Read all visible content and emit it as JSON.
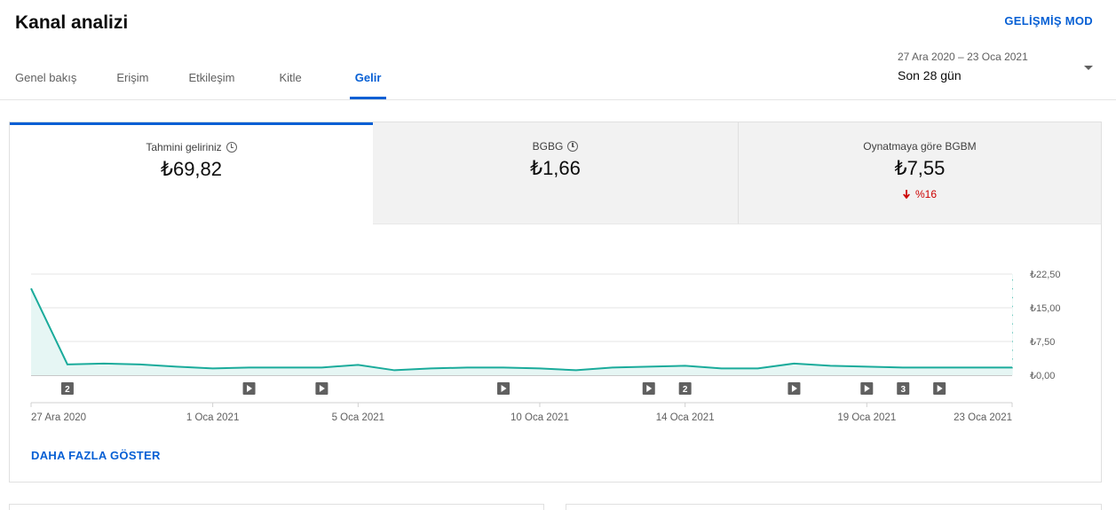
{
  "page": {
    "title": "Kanal analizi",
    "advanced_mode": "GELİŞMİŞ MOD"
  },
  "tabs": [
    {
      "label": "Genel bakış",
      "active": false
    },
    {
      "label": "Erişim",
      "active": false
    },
    {
      "label": "Etkileşim",
      "active": false
    },
    {
      "label": "Kitle",
      "active": false
    },
    {
      "label": "Gelir",
      "active": true
    }
  ],
  "date_range": {
    "range": "27 Ara 2020 – 23 Oca 2021",
    "label": "Son 28 gün"
  },
  "metrics": [
    {
      "label": "Tahmini geliriniz",
      "value": "₺69,82",
      "has_clock": true,
      "selected": true,
      "delta": ""
    },
    {
      "label": "BGBG",
      "value": "₺1,66",
      "has_clock": true,
      "selected": false,
      "delta": ""
    },
    {
      "label": "Oynatmaya göre BGBM",
      "value": "₺7,55",
      "has_clock": false,
      "selected": false,
      "delta": "%16"
    }
  ],
  "colors": {
    "accent": "#065fd4",
    "line": "#1aab9b",
    "negative": "#cc0000"
  },
  "chart_data": {
    "type": "area",
    "x": [
      "27 Ara",
      "28 Ara",
      "29 Ara",
      "30 Ara",
      "31 Ara",
      "1 Oca",
      "2 Oca",
      "3 Oca",
      "4 Oca",
      "5 Oca",
      "6 Oca",
      "7 Oca",
      "8 Oca",
      "9 Oca",
      "10 Oca",
      "11 Oca",
      "12 Oca",
      "13 Oca",
      "14 Oca",
      "15 Oca",
      "16 Oca",
      "17 Oca",
      "18 Oca",
      "19 Oca",
      "20 Oca",
      "21 Oca",
      "22 Oca"
    ],
    "y": [
      19.3,
      2.4,
      2.6,
      2.4,
      1.9,
      1.5,
      1.7,
      1.7,
      1.7,
      2.3,
      1.1,
      1.5,
      1.7,
      1.7,
      1.5,
      1.1,
      1.7,
      1.9,
      2.1,
      1.5,
      1.5,
      2.6,
      2.1,
      1.9,
      1.7,
      1.7,
      1.7
    ],
    "ylim": [
      0,
      22.5
    ],
    "y_ticks": [
      "₺22,50",
      "₺15,00",
      "₺7,50",
      "₺0,00"
    ],
    "x_ticks": [
      "27 Ara 2020",
      "1 Oca 2021",
      "5 Oca 2021",
      "10 Oca 2021",
      "14 Oca 2021",
      "19 Oca 2021",
      "23 Oca 2021"
    ],
    "x_tick_day_index": [
      0,
      5,
      9,
      14,
      18,
      23,
      27
    ],
    "pending_last_day": true,
    "markers": [
      {
        "day_index": 1,
        "kind": "count",
        "label": "2"
      },
      {
        "day_index": 6,
        "kind": "video",
        "label": ""
      },
      {
        "day_index": 8,
        "kind": "video",
        "label": ""
      },
      {
        "day_index": 13,
        "kind": "video",
        "label": ""
      },
      {
        "day_index": 17,
        "kind": "video",
        "label": ""
      },
      {
        "day_index": 18,
        "kind": "count",
        "label": "2"
      },
      {
        "day_index": 21,
        "kind": "video",
        "label": ""
      },
      {
        "day_index": 23,
        "kind": "video",
        "label": ""
      },
      {
        "day_index": 24,
        "kind": "count",
        "label": "3"
      },
      {
        "day_index": 25,
        "kind": "video",
        "label": ""
      }
    ]
  },
  "show_more": "DAHA FAZLA GÖSTER"
}
